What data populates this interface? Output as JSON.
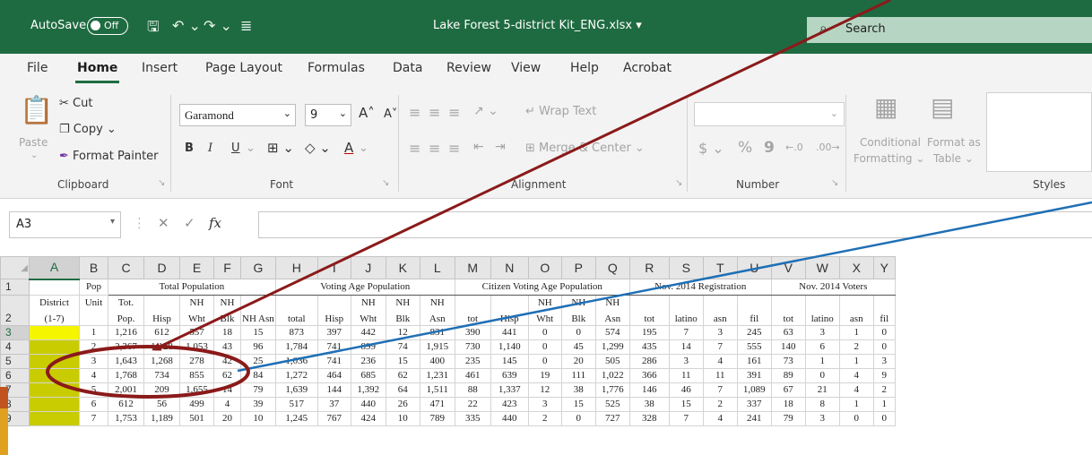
{
  "titlebar": {
    "autosave_label": "AutoSave",
    "autosave_state": "Off",
    "filename": "Lake Forest 5-district Kit_ENG.xlsx",
    "filename_caret": "▾",
    "search_placeholder": "Search"
  },
  "menu": [
    "File",
    "Home",
    "Insert",
    "Page Layout",
    "Formulas",
    "Data",
    "Review",
    "View",
    "Help",
    "Acrobat"
  ],
  "ribbon": {
    "clipboard": {
      "label": "Clipboard",
      "paste": "Paste",
      "cut": "Cut",
      "copy": "Copy",
      "format_painter": "Format Painter"
    },
    "font": {
      "label": "Font",
      "name": "Garamond",
      "size": "9",
      "bold": "B",
      "italic": "I",
      "underline": "U"
    },
    "alignment": {
      "label": "Alignment",
      "wrap": "Wrap Text",
      "merge": "Merge & Center"
    },
    "number": {
      "label": "Number",
      "currency": "$",
      "percent": "%",
      "comma": "9"
    },
    "styles": {
      "label": "Styles",
      "conditional": [
        "Conditional",
        "Formatting"
      ],
      "format_table": [
        "Format as",
        "Table"
      ]
    }
  },
  "formula_bar": {
    "name_box": "A3",
    "fx": "fx",
    "cancel": "✕",
    "enter": "✓"
  },
  "grid": {
    "columns": [
      "A",
      "B",
      "C",
      "D",
      "E",
      "F",
      "G",
      "H",
      "I",
      "J",
      "K",
      "L",
      "M",
      "N",
      "O",
      "P",
      "Q",
      "R",
      "S",
      "T",
      "U",
      "V",
      "W",
      "X",
      "Y"
    ],
    "row1_groups": {
      "pop": "Pop",
      "total_population": "Total Population",
      "voting_age_population": "Voting Age Population",
      "cvap": "Citizen Voting Age Population",
      "registration": "Nov. 2014 Registration",
      "voters": "Nov. 2014 Voters"
    },
    "row2_top": [
      "District",
      "Unit",
      "Tot.",
      "",
      "NH",
      "NH",
      "",
      "",
      "",
      "NH",
      "NH",
      "NH",
      "",
      "",
      "NH",
      "NH",
      "NH",
      "",
      "",
      "",
      "",
      "",
      "",
      "",
      ""
    ],
    "row2_bottom": [
      "(1-7)",
      "",
      "Pop.",
      "Hisp",
      "Wht",
      "Blk",
      "NH Asn",
      "total",
      "Hisp",
      "Wht",
      "Blk",
      "Asn",
      "tot",
      "Hisp",
      "Wht",
      "Blk",
      "Asn",
      "tot",
      "latino",
      "asn",
      "fil",
      "tot",
      "latino",
      "asn",
      "fil"
    ],
    "row_numbers": [
      "1",
      "2",
      "3",
      "4",
      "5",
      "6",
      "7",
      "8",
      "9"
    ],
    "data_rows": [
      [
        "",
        "1",
        "1,216",
        "612",
        "557",
        "18",
        "15",
        "873",
        "397",
        "442",
        "12",
        "831",
        "390",
        "441",
        "0",
        "0",
        "574",
        "195",
        "7",
        "3",
        "245",
        "63",
        "3",
        "1",
        "0"
      ],
      [
        "",
        "2",
        "2,367",
        "1,128",
        "1,053",
        "43",
        "96",
        "1,784",
        "741",
        "899",
        "74",
        "1,915",
        "730",
        "1,140",
        "0",
        "45",
        "1,299",
        "435",
        "14",
        "7",
        "555",
        "140",
        "6",
        "2",
        "0"
      ],
      [
        "",
        "3",
        "1,643",
        "1,268",
        "278",
        "42",
        "25",
        "1,036",
        "741",
        "236",
        "15",
        "400",
        "235",
        "145",
        "0",
        "20",
        "505",
        "286",
        "3",
        "4",
        "161",
        "73",
        "1",
        "1",
        "3"
      ],
      [
        "",
        "4",
        "1,768",
        "734",
        "855",
        "62",
        "84",
        "1,272",
        "464",
        "685",
        "62",
        "1,231",
        "461",
        "639",
        "19",
        "111",
        "1,022",
        "366",
        "11",
        "11",
        "391",
        "89",
        "0",
        "4",
        "9"
      ],
      [
        "",
        "5",
        "2,001",
        "209",
        "1,655",
        "14",
        "79",
        "1,639",
        "144",
        "1,392",
        "64",
        "1,511",
        "88",
        "1,337",
        "12",
        "38",
        "1,776",
        "146",
        "46",
        "7",
        "1,089",
        "67",
        "21",
        "4",
        "2"
      ],
      [
        "",
        "6",
        "612",
        "56",
        "499",
        "4",
        "39",
        "517",
        "37",
        "440",
        "26",
        "471",
        "22",
        "423",
        "3",
        "15",
        "525",
        "38",
        "15",
        "2",
        "337",
        "18",
        "8",
        "1",
        "1"
      ],
      [
        "",
        "7",
        "1,753",
        "1,189",
        "501",
        "20",
        "10",
        "1,245",
        "767",
        "424",
        "10",
        "789",
        "335",
        "440",
        "2",
        "0",
        "727",
        "328",
        "7",
        "4",
        "241",
        "79",
        "3",
        "0",
        "0"
      ]
    ]
  },
  "colors": {
    "excel_green": "#1f6b41",
    "highlight_yellow": "#f5f500",
    "highlight_olive": "#c8cc00",
    "arrow_red": "#8b1a1a",
    "line_blue": "#1f6fb5"
  }
}
